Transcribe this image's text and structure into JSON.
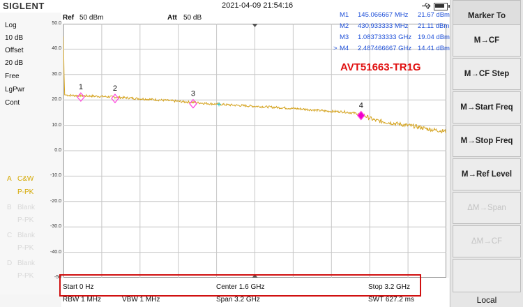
{
  "status": {
    "brand": "SIGLENT",
    "datetime": "2021-04-09 21:54:16"
  },
  "left_panel": {
    "scale_type": "Log",
    "scale_div": "10 dB",
    "offset_label": "Offset",
    "offset_value": "20 dB",
    "trigger": "Free",
    "detector": "LgPwr",
    "sweep": "Cont",
    "traces": [
      {
        "letter": "A",
        "mode": "C&W",
        "det": "P-PK",
        "active": true
      },
      {
        "letter": "B",
        "mode": "Blank",
        "det": "P-PK",
        "active": false
      },
      {
        "letter": "C",
        "mode": "Blank",
        "det": "P-PK",
        "active": false
      },
      {
        "letter": "D",
        "mode": "Blank",
        "det": "P-PK",
        "active": false
      }
    ]
  },
  "header": {
    "ref_label": "Ref",
    "ref_value": "50 dBm",
    "att_label": "Att",
    "att_value": "50 dB"
  },
  "markers": [
    {
      "name": "M1",
      "freq": "145.066667 MHz",
      "level": "21.67 dBm",
      "selected": false
    },
    {
      "name": "M2",
      "freq": "430.933333 MHz",
      "level": "21.11 dBm",
      "selected": false
    },
    {
      "name": "M3",
      "freq": "1.083733333 GHz",
      "level": "19.04 dBm",
      "selected": false
    },
    {
      "name": "M4",
      "freq": "2.487466667 GHz",
      "level": "14.41 dBm",
      "selected": true
    }
  ],
  "selected_marker_prefix": ">",
  "watermark": "AVT51663-TR1G",
  "plot_labels": [
    "1",
    "2",
    "3",
    "4"
  ],
  "y_ticks": [
    "50.0",
    "40.0",
    "30.0",
    "20.0",
    "10.0",
    "0.0",
    "-10.0",
    "-20.0",
    "-30.0",
    "-40.0",
    "-50"
  ],
  "footer": {
    "start": "Start  0 Hz",
    "center": "Center  1.6 GHz",
    "stop": "Stop  3.2 GHz",
    "rbw": "RBW  1 MHz",
    "vbw": "VBW  1 MHz",
    "span": "Span   3.2 GHz",
    "swt": "SWT  627.2 ms"
  },
  "menu": {
    "title": "Marker To",
    "items": [
      {
        "label": "M→CF",
        "enabled": true
      },
      {
        "label": "M→CF Step",
        "enabled": true
      },
      {
        "label": "M→Start Freq",
        "enabled": true
      },
      {
        "label": "M→Stop Freq",
        "enabled": true
      },
      {
        "label": "M→Ref Level",
        "enabled": true
      },
      {
        "label": "ΔM→Span",
        "enabled": false
      },
      {
        "label": "ΔM→CF",
        "enabled": false
      }
    ],
    "local": "Local"
  },
  "colors": {
    "trace": "#d4a21c",
    "marker": "#ff44dd",
    "marker_active": "#ee00cc",
    "marker_text": "#1d4fd8",
    "watermark": "#e01010",
    "highlight": "#d01010"
  },
  "chart_data": {
    "type": "line",
    "title": "",
    "xlabel": "",
    "ylabel": "",
    "x_unit": "GHz",
    "y_unit": "dBm",
    "xlim": [
      0,
      3.2
    ],
    "ylim": [
      -50,
      50
    ],
    "series": [
      {
        "x": [
          0,
          0.005,
          0.01,
          0.05,
          0.145,
          0.3,
          0.431,
          0.6,
          0.8,
          1.0,
          1.084,
          1.2,
          1.4,
          1.6,
          1.8,
          2.0,
          2.2,
          2.35,
          2.487,
          2.6,
          2.8,
          2.95,
          3.05,
          3.2
        ],
        "y": [
          45,
          30,
          22,
          21.8,
          21.67,
          21.4,
          21.11,
          20.6,
          20.0,
          19.3,
          19.04,
          18.6,
          18.0,
          17.5,
          17.0,
          16.4,
          15.6,
          15.3,
          14.41,
          12.0,
          10.5,
          9.5,
          8.5,
          7.6
        ]
      }
    ],
    "markers": [
      {
        "label": "1",
        "x": 0.145066667,
        "y": 21.67
      },
      {
        "label": "2",
        "x": 0.430933333,
        "y": 21.11
      },
      {
        "label": "3",
        "x": 1.083733333,
        "y": 19.04
      },
      {
        "label": "4",
        "x": 2.487466667,
        "y": 14.41
      }
    ],
    "grid": true
  }
}
